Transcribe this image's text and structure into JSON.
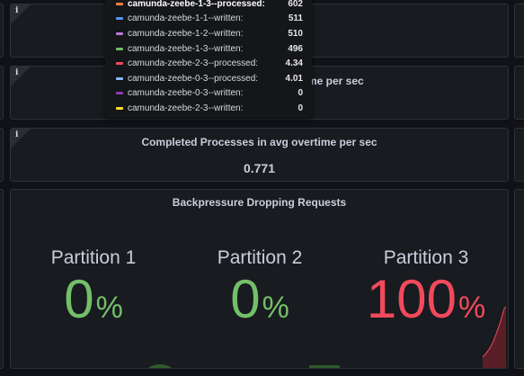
{
  "panels": {
    "top1": {
      "title": "",
      "value": ""
    },
    "top2": {
      "title": "me per sec",
      "value": ""
    },
    "completed": {
      "title": "Completed Processes in avg overtime per sec",
      "value": "0.771"
    }
  },
  "backpressure": {
    "title": "Backpressure Dropping Requests",
    "partitions": [
      {
        "label": "Partition 1",
        "value": "0",
        "unit": "%",
        "color": "#73bf69"
      },
      {
        "label": "Partition 2",
        "value": "0",
        "unit": "%",
        "color": "#73bf69"
      },
      {
        "label": "Partition 3",
        "value": "100",
        "unit": "%",
        "color": "#f2495c"
      }
    ]
  },
  "info_icon": "i",
  "tooltip": {
    "rows": [
      {
        "name": "camunda-zeebe-1-3--processed:",
        "value": "602",
        "color": "#ff7f3f"
      },
      {
        "name": "camunda-zeebe-1-1--written:",
        "value": "511",
        "color": "#5794f2"
      },
      {
        "name": "camunda-zeebe-1-2--written:",
        "value": "510",
        "color": "#b877d9"
      },
      {
        "name": "camunda-zeebe-1-3--written:",
        "value": "496",
        "color": "#73bf69"
      },
      {
        "name": "camunda-zeebe-2-3--processed:",
        "value": "4.34",
        "color": "#f2495c"
      },
      {
        "name": "camunda-zeebe-0-3--processed:",
        "value": "4.01",
        "color": "#8ab8ff"
      },
      {
        "name": "camunda-zeebe-0-3--written:",
        "value": "0",
        "color": "#8f3bb8"
      },
      {
        "name": "camunda-zeebe-2-3--written:",
        "value": "0",
        "color": "#fade2a"
      }
    ]
  }
}
